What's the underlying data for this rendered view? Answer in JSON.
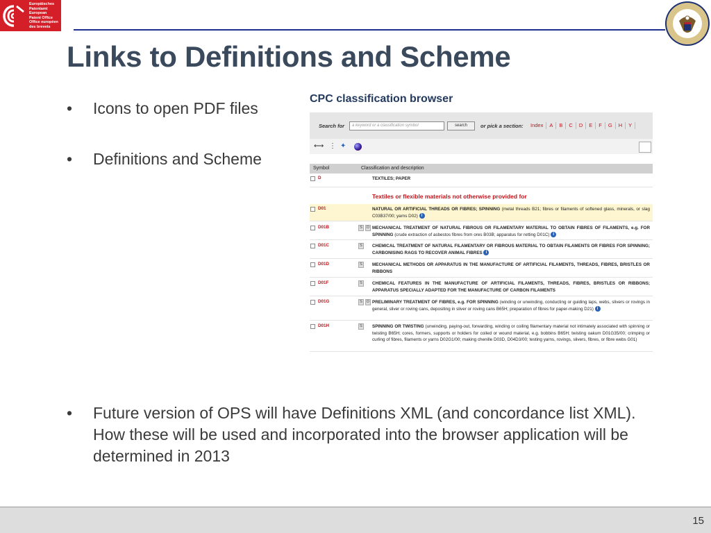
{
  "header": {
    "epo_logo_text": "Europäisches\nPatentamt\nEuropean\nPatent Office\nOffice européen\ndes brevets",
    "epo_logo_icon": "epo-swirl-icon",
    "uspto_seal_icon": "uspto-seal-icon",
    "uspto_seal_text": "UNITED STATES PATENT AND TRADEMARK OFFICE · DEPARTMENT OF COMMERCE"
  },
  "slide": {
    "title": "Links to Definitions and Scheme",
    "bullets": [
      {
        "dot": "•",
        "text": "Icons to open PDF files"
      },
      {
        "dot": "•",
        "text": "Definitions and Scheme"
      },
      {
        "dot": "•",
        "text": "Future version of OPS will have Definitions XML (and concordance list XML).  How these will be used and incorporated into the browser application will be determined in 2013"
      }
    ],
    "page_number": "15"
  },
  "cpc_browser": {
    "title": "CPC classification browser",
    "search_label": "Search for",
    "search_placeholder": "a keyword or a classification symbol",
    "search_button": "search",
    "pick_label": "or pick a section:",
    "sections": [
      "Index",
      "A",
      "B",
      "C",
      "D",
      "E",
      "F",
      "G",
      "H",
      "Y"
    ],
    "tool_icons": [
      "expand-arrows-icon",
      "tree-icon",
      "colorize-icon",
      "globe-icon"
    ],
    "column_symbol": "Symbol",
    "column_description": "Classification and description",
    "subheading": "Textiles or flexible materials not otherwise provided for",
    "rows": [
      {
        "symbol": "D",
        "s": "",
        "d": "",
        "title": "TEXTILES; PAPER",
        "note": "",
        "refs": ""
      },
      {
        "symbol": "D01",
        "s": "",
        "d": "",
        "title": "NATURAL OR ARTIFICIAL THREADS OR FIBRES; SPINNING",
        "note": "(metal threads B21; fibres or filaments of softened glass, minerals, or slag C03B37/00; yarns D02)",
        "refs": ""
      },
      {
        "symbol": "D01B",
        "s": "S",
        "d": "D",
        "title": "MECHANICAL TREATMENT OF NATURAL FIBROUS OR FILAMENTARY MATERIAL TO OBTAIN FIBRES OF FILAMENTS, e.g. FOR SPINNING",
        "note": "(crude extraction of asbestos fibres from ores B03B; apparatus for retting D01C)",
        "refs": ""
      },
      {
        "symbol": "D01C",
        "s": "S",
        "d": "",
        "title": "CHEMICAL TREATMENT OF NATURAL FILAMENTARY OR FIBROUS MATERIAL TO OBTAIN FILAMENTS OR FIBRES FOR SPINNING; CARBONISING RAGS TO RECOVER ANIMAL FIBRES",
        "note": "",
        "refs": ""
      },
      {
        "symbol": "D01D",
        "s": "S",
        "d": "",
        "title": "MECHANICAL METHODS OR APPARATUS IN THE MANUFACTURE OF ARTIFICIAL FILAMENTS, THREADS, FIBRES, BRISTLES OR RIBBONS",
        "note": "",
        "refs": ""
      },
      {
        "symbol": "D01F",
        "s": "S",
        "d": "",
        "title": "CHEMICAL FEATURES IN THE MANUFACTURE OF ARTIFICIAL FILAMENTS, THREADS, FIBRES, BRISTLES OR RIBBONS; APPARATUS SPECIALLY ADAPTED FOR THE MANUFACTURE OF CARBON FILAMENTS",
        "note": "",
        "refs": ""
      },
      {
        "symbol": "D01G",
        "s": "S",
        "d": "D",
        "title": "PRELIMINARY TREATMENT OF FIBRES, e.g. FOR SPINNING",
        "note": "(winding or unwinding, conducting or guiding laps, webs, slivers or rovings in general, sliver or roving cans, depositing in sliver or roving cans B65H; preparation of fibres for paper-making D21)",
        "refs": ""
      },
      {
        "symbol": "D01H",
        "s": "S",
        "d": "",
        "title": "SPINNING OR TWISTING",
        "note": "(unwinding, paying-out, forwarding, winding or coiling filamentary material not intimately associated with spinning or twisting B65H; cores, formers, supports or holders for coiled or wound material, e.g. bobbins B65H; twisting oakum D01G35/00; crimping or curling of fibres, filaments or yarns D02G1/00; making chenille D03D, D04D3/00; testing yarns, rovings, slivers, fibres, or fibre webs G01)",
        "refs": ""
      }
    ],
    "info_glyph": "i"
  }
}
